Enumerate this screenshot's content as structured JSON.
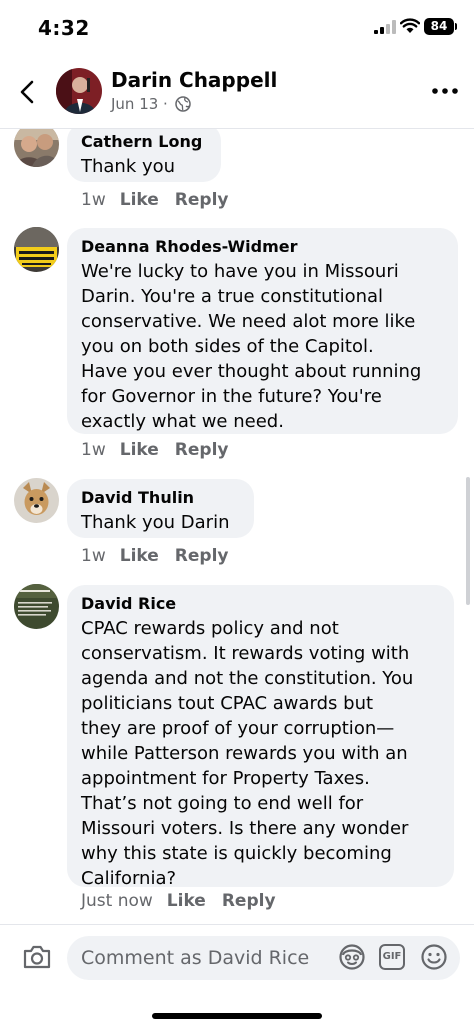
{
  "status_bar": {
    "time": "4:32",
    "battery": "84"
  },
  "header": {
    "name": "Darin Chappell",
    "date": "Jun 13 ·"
  },
  "comments": [
    {
      "author": "Cathern Long",
      "text": "Thank you",
      "time": "1w",
      "like": "Like",
      "reply": "Reply"
    },
    {
      "author": "Deanna Rhodes-Widmer",
      "text": "We're lucky to have you in Missouri\nDarin. You're a true constitutional\nconservative. We need alot more like\nyou on both sides of the Capitol.\nHave you ever thought about running\nfor Governor in the future?  You're\nexactly what we need.",
      "time": "1w",
      "like": "Like",
      "reply": "Reply"
    },
    {
      "author": "David Thulin",
      "text": "Thank you Darin",
      "time": "1w",
      "like": "Like",
      "reply": "Reply"
    },
    {
      "author": "David Rice",
      "text": "CPAC rewards policy and not\nconservatism. It rewards voting with\nagenda and not the constitution. You\npoliticians tout CPAC awards but\nthey are proof of your corruption—\nwhile Patterson rewards you with an\nappointment for Property Taxes.\nThat’s not going to end well for\nMissouri voters. Is there any wonder\nwhy this state is quickly becoming\nCalifornia?",
      "time": "Just now",
      "like": "Like",
      "reply": "Reply"
    }
  ],
  "composer": {
    "placeholder": "Comment as David Rice",
    "gif_label": "GIF"
  },
  "icons": {
    "back": "chevron-left-icon",
    "globe": "globe-icon",
    "more": "more-dots-icon",
    "camera": "camera-icon",
    "avatar_sticker": "avatar-sticker-icon",
    "gif": "gif-icon",
    "emoji": "emoji-icon"
  }
}
